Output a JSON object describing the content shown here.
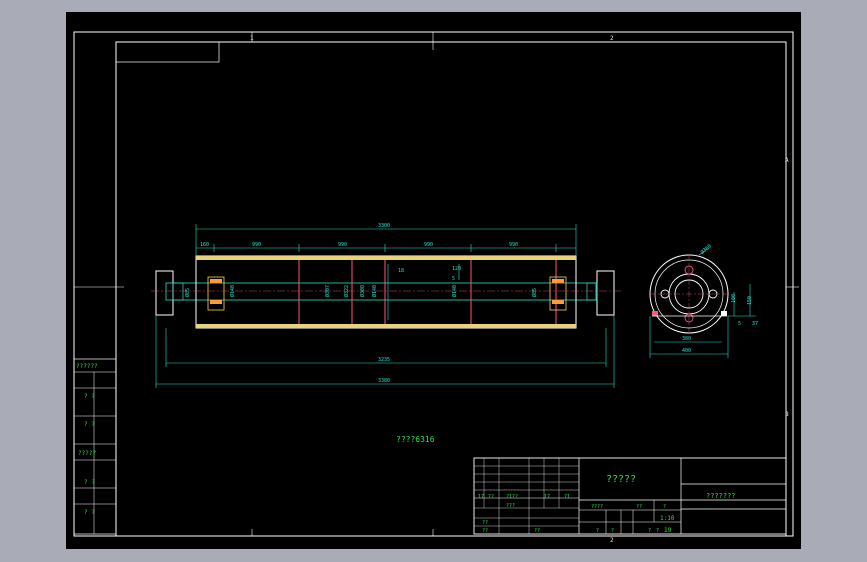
{
  "zone_labels": {
    "top_left": "1",
    "top_mid": "2",
    "bottom_mid": "2",
    "right_upper": "A",
    "right_lower": "B"
  },
  "sidebar_labels": [
    "??????",
    "? ?",
    "? ?",
    "?????",
    "? ?",
    "? ?"
  ],
  "drawing_note": "????6316",
  "dimensions": {
    "shell_overall": "3300",
    "seg1": "160",
    "seg2": "990",
    "seg3": "990",
    "seg4": "990",
    "seg5": "990",
    "bearing_span": "3235",
    "shaft_total": "3380",
    "dia_shaft_end": "Ø85",
    "dia_bearing": "Ø140",
    "dia_shell_a": "Ø307",
    "dia_shell_b": "Ø322",
    "dia_inner": "Ø300",
    "dia_hub": "Ø140",
    "dia_end2": "Ø140",
    "dia_end3": "Ø85",
    "rib": "18",
    "gap1": "120",
    "gap2": "5",
    "side_diam": "Ø360",
    "side_w1": "380",
    "side_w2": "400",
    "side_h1": "100",
    "side_h2": "150",
    "side_t": "5",
    "side_r": "37"
  },
  "title_block": {
    "title": "?????",
    "drawing_no": "???????",
    "scale": "1:10",
    "r1": [
      "17",
      "??",
      "?1??",
      "17",
      "?1"
    ],
    "r2": [
      "????",
      "??",
      "?"
    ],
    "r3": [
      "??",
      "???"
    ],
    "r4": [
      "??",
      "??",
      "?",
      "?",
      "?",
      "?"
    ],
    "sheet": "19"
  }
}
